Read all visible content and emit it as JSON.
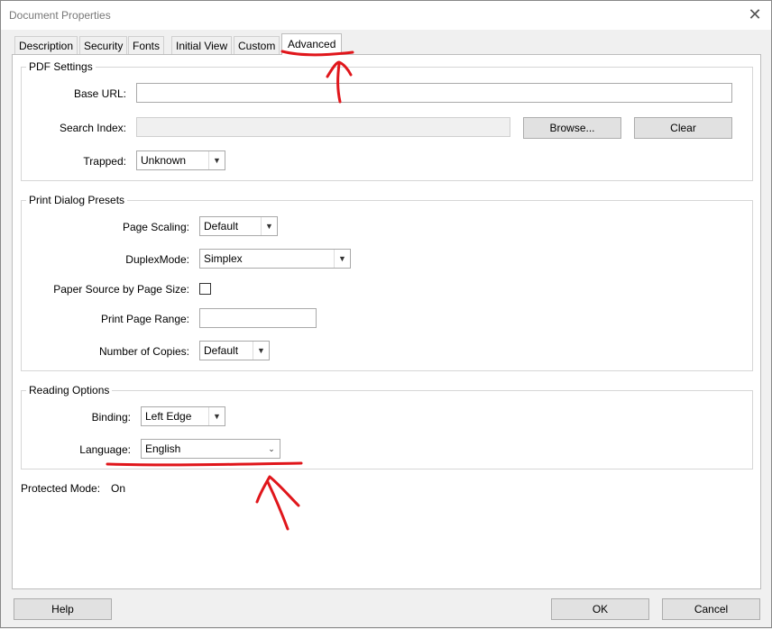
{
  "window": {
    "title": "Document Properties",
    "close_glyph": "✕"
  },
  "tabs": [
    {
      "label": "Description"
    },
    {
      "label": "Security"
    },
    {
      "label": "Fonts"
    },
    {
      "label": "Initial View"
    },
    {
      "label": "Custom"
    },
    {
      "label": "Advanced",
      "active": true
    }
  ],
  "pdf_settings": {
    "title": "PDF Settings",
    "base_url_label": "Base URL:",
    "base_url_value": "",
    "search_index_label": "Search Index:",
    "search_index_value": "",
    "browse_label": "Browse...",
    "clear_label": "Clear",
    "trapped_label": "Trapped:",
    "trapped_value": "Unknown"
  },
  "print_presets": {
    "title": "Print Dialog Presets",
    "page_scaling_label": "Page Scaling:",
    "page_scaling_value": "Default",
    "duplex_label": "DuplexMode:",
    "duplex_value": "Simplex",
    "paper_source_label": "Paper Source by Page Size:",
    "paper_source_checked": false,
    "print_range_label": "Print Page Range:",
    "print_range_value": "",
    "copies_label": "Number of Copies:",
    "copies_value": "Default"
  },
  "reading_options": {
    "title": "Reading Options",
    "binding_label": "Binding:",
    "binding_value": "Left Edge",
    "language_label": "Language:",
    "language_value": "English"
  },
  "protected_mode": {
    "label": "Protected Mode:",
    "value": "On"
  },
  "footer": {
    "help_label": "Help",
    "ok_label": "OK",
    "cancel_label": "Cancel"
  },
  "icons": {
    "dropdown": "chevron-down-icon",
    "close": "close-icon"
  },
  "colors": {
    "annotation": "#e0161b",
    "background": "#f0f0f0",
    "panel": "#ffffff"
  }
}
